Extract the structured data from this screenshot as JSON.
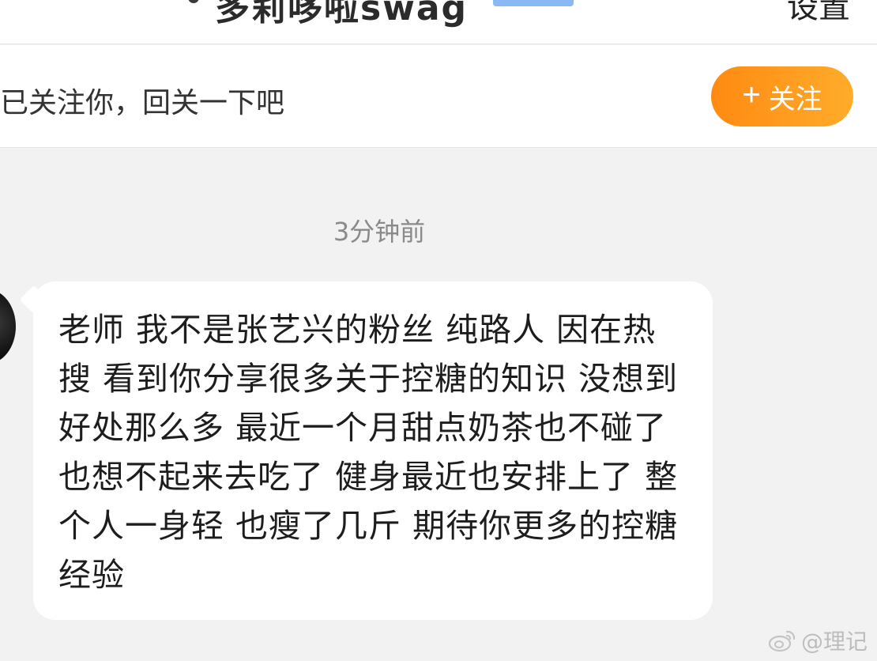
{
  "header": {
    "title": "多莉哆啦swag",
    "settings_label": "设置"
  },
  "follow_bar": {
    "text": "已关注你，回关一下吧",
    "button_label": "关注",
    "button_icon": "plus-icon"
  },
  "chat": {
    "timestamp": "3分钟前",
    "message": "老师 我不是张艺兴的粉丝 纯路人 因在热搜 看到你分享很多关于控糖的知识 没想到好处那么多 最近一个月甜点奶茶也不碰了 也想不起来去吃了 健身最近也安排上了 整个人一身轻 也瘦了几斤 期待你更多的控糖经验"
  },
  "watermark": {
    "icon": "weibo-icon",
    "text": "@理记"
  },
  "colors": {
    "follow_button_start": "#ff8a12",
    "follow_button_end": "#ffac2a",
    "chat_background": "#f2f2f2"
  }
}
